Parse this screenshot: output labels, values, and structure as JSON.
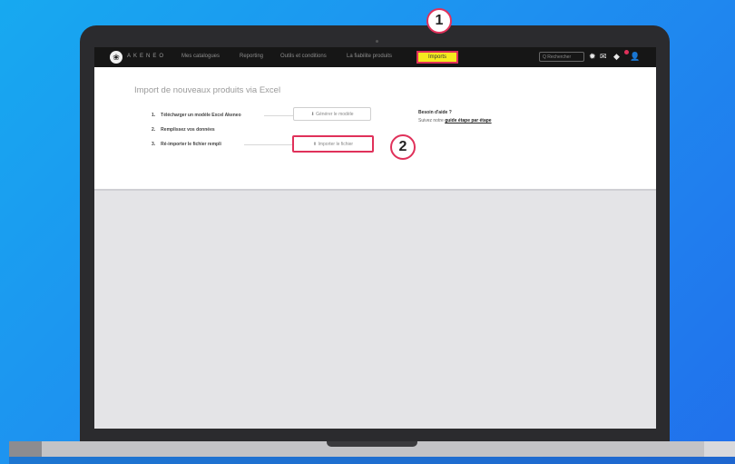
{
  "brand": "AKENEO",
  "nav": [
    "Mes catalogues",
    "Reporting",
    "Outils et conditions",
    "La fiabilite produits"
  ],
  "active_nav": "Imports",
  "search_placeholder": "Q Rechercher",
  "page_title": "Import de nouveaux produits via Excel",
  "steps": [
    {
      "num": "1.",
      "text": "Télécharger un modèle Excel Akeneo"
    },
    {
      "num": "2.",
      "text": "Remplissez vos données"
    },
    {
      "num": "3.",
      "text": "Ré-importer le fichier rempli"
    }
  ],
  "buttons": {
    "download": "⬇ Générer le modèle",
    "import": "⬆ Importer le fichier"
  },
  "help": {
    "title": "Besoin d'aide ?",
    "text": "Suivez notre",
    "link": "guide étape par étape"
  },
  "callouts": [
    "1",
    "2"
  ],
  "colors": {
    "highlight": "#e0315a",
    "active_tab": "#f5ea1e",
    "background": "#1e90f0"
  },
  "icons": [
    "logo-icon",
    "settings-icon",
    "chat-icon",
    "notification-icon",
    "user-icon"
  ]
}
